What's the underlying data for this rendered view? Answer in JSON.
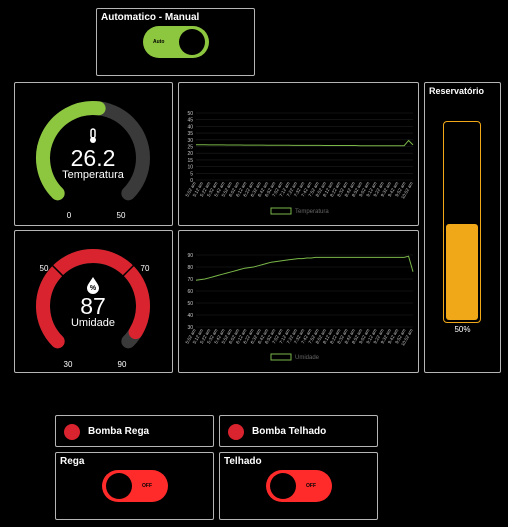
{
  "mode_panel": {
    "title": "Automatico - Manual",
    "switch_label": "Auto",
    "switch_on": true,
    "on_color": "#8dc63f"
  },
  "temperature_gauge": {
    "value": 26.2,
    "value_text": "26.2",
    "label": "Temperatura",
    "min": 0,
    "max": 50,
    "min_label": "0",
    "max_label": "50",
    "icon": "thermometer-icon",
    "color": "#8dc63f"
  },
  "humidity_gauge": {
    "value": 87,
    "value_text": "87",
    "label": "Umidade",
    "min": 30,
    "max": 90,
    "min_label": "30",
    "max_label": "90",
    "low_mark_label": "50",
    "high_mark_label": "70",
    "icon": "humidity-drop-icon",
    "color": "#d9232e"
  },
  "reservoir": {
    "title": "Reservatório",
    "level": 0.5,
    "level_text": "50%",
    "color": "#f0a818"
  },
  "chart_data": [
    {
      "type": "line",
      "series": [
        {
          "name": "Temperatura",
          "values": [
            26.3,
            26.3,
            26.3,
            26.2,
            26.2,
            26.2,
            26.2,
            26.1,
            26.1,
            26.1,
            26.1,
            26.0,
            26.0,
            26.0,
            26.0,
            26.0,
            25.9,
            25.9,
            25.9,
            25.9,
            25.9,
            25.9,
            25.8,
            25.8,
            25.8,
            25.8,
            25.8,
            25.8,
            25.8,
            25.7,
            25.7,
            25.7,
            25.7,
            25.7,
            25.7,
            25.7,
            25.7,
            25.6,
            25.6,
            25.6,
            25.6,
            25.6,
            25.6,
            25.6,
            25.6,
            25.6,
            25.6,
            25.6,
            29.5,
            26.2
          ]
        }
      ],
      "ylim": [
        0,
        50
      ],
      "yticks": [
        "0",
        "5",
        "10",
        "15",
        "20",
        "25",
        "30",
        "35",
        "40",
        "45",
        "50"
      ],
      "xticks": [
        "5:02 am",
        "5:12 am",
        "5:22 am",
        "5:32 am",
        "5:42 am",
        "5:52 am",
        "6:02 am",
        "6:12 am",
        "6:22 am",
        "6:32 am",
        "6:42 am",
        "6:52 am",
        "7:02 am",
        "7:12 am",
        "7:22 am",
        "7:32 am",
        "7:42 am",
        "7:52 am",
        "8:02 am",
        "8:12 am",
        "8:22 am",
        "8:32 am",
        "8:42 am",
        "8:52 am",
        "9:02 am",
        "9:12 am",
        "9:22 am",
        "9:32 am",
        "9:42 am",
        "9:52 am",
        "10:02 am"
      ],
      "grid": true,
      "legend": "bottom",
      "color": "#7ab648"
    },
    {
      "type": "line",
      "series": [
        {
          "name": "Umidade",
          "values": [
            69,
            69.5,
            70,
            71,
            72,
            73,
            74,
            75,
            76,
            77,
            78,
            79,
            79.5,
            80,
            81,
            82,
            83,
            84,
            84.5,
            85,
            85.5,
            86,
            86.5,
            87,
            87,
            87.5,
            87.5,
            88,
            88,
            88,
            88,
            88,
            88,
            88,
            88,
            88,
            88,
            88,
            88,
            88,
            88,
            88,
            88,
            88,
            88,
            88,
            88,
            88,
            89,
            76
          ]
        }
      ],
      "ylim": [
        30,
        90
      ],
      "yticks": [
        "30",
        "40",
        "50",
        "60",
        "70",
        "80",
        "90"
      ],
      "xticks": [
        "5:02 am",
        "5:12 am",
        "5:22 am",
        "5:32 am",
        "5:42 am",
        "5:52 am",
        "6:02 am",
        "6:12 am",
        "6:22 am",
        "6:32 am",
        "6:42 am",
        "6:52 am",
        "7:02 am",
        "7:12 am",
        "7:22 am",
        "7:32 am",
        "7:42 am",
        "7:52 am",
        "8:02 am",
        "8:12 am",
        "8:22 am",
        "8:32 am",
        "8:42 am",
        "8:52 am",
        "9:02 am",
        "9:12 am",
        "9:22 am",
        "9:32 am",
        "9:42 am",
        "9:52 am",
        "10:02 am"
      ],
      "grid": true,
      "legend": "bottom",
      "color": "#7ab648"
    }
  ],
  "indicators": [
    {
      "label": "Bomba Rega",
      "color": "#d9232e"
    },
    {
      "label": "Bomba Telhado",
      "color": "#d9232e"
    }
  ],
  "switches": [
    {
      "title": "Rega",
      "state_label": "OFF",
      "on": false,
      "color": "#ff2a2a"
    },
    {
      "title": "Telhado",
      "state_label": "OFF",
      "on": false,
      "color": "#ff2a2a"
    }
  ]
}
